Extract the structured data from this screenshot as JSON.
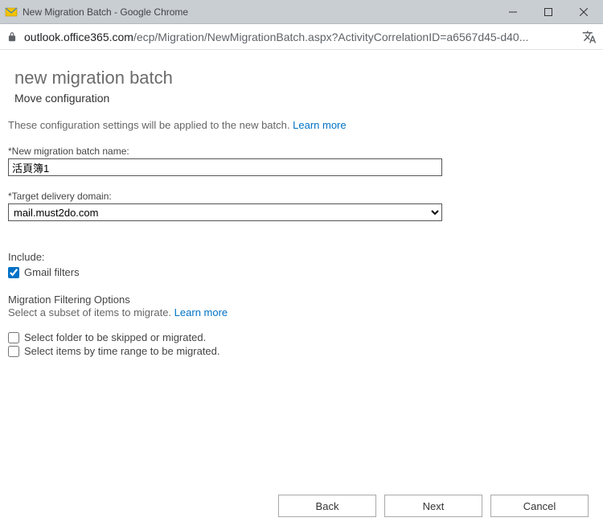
{
  "window": {
    "title": "New Migration Batch - Google Chrome"
  },
  "addressbar": {
    "host": "outlook.office365.com",
    "path": "/ecp/Migration/NewMigrationBatch.aspx?ActivityCorrelationID=a6567d45-d40..."
  },
  "page": {
    "title": "new migration batch",
    "subtitle": "Move configuration",
    "description": "These configuration settings will be applied to the new batch.",
    "learn_more": "Learn more"
  },
  "fields": {
    "batch_name_label": "*New migration batch name:",
    "batch_name_value": "活頁簿1",
    "target_domain_label": "*Target delivery domain:",
    "target_domain_value": "mail.must2do.com"
  },
  "include": {
    "label": "Include:",
    "gmail_filters_label": "Gmail filters",
    "gmail_filters_checked": true
  },
  "filtering": {
    "header": "Migration Filtering Options",
    "sub": "Select a subset of items to migrate.",
    "learn_more": "Learn more",
    "folder_label": "Select folder to be skipped or migrated.",
    "folder_checked": false,
    "time_label": "Select items by time range to be migrated.",
    "time_checked": false
  },
  "buttons": {
    "back": "Back",
    "next": "Next",
    "cancel": "Cancel"
  }
}
